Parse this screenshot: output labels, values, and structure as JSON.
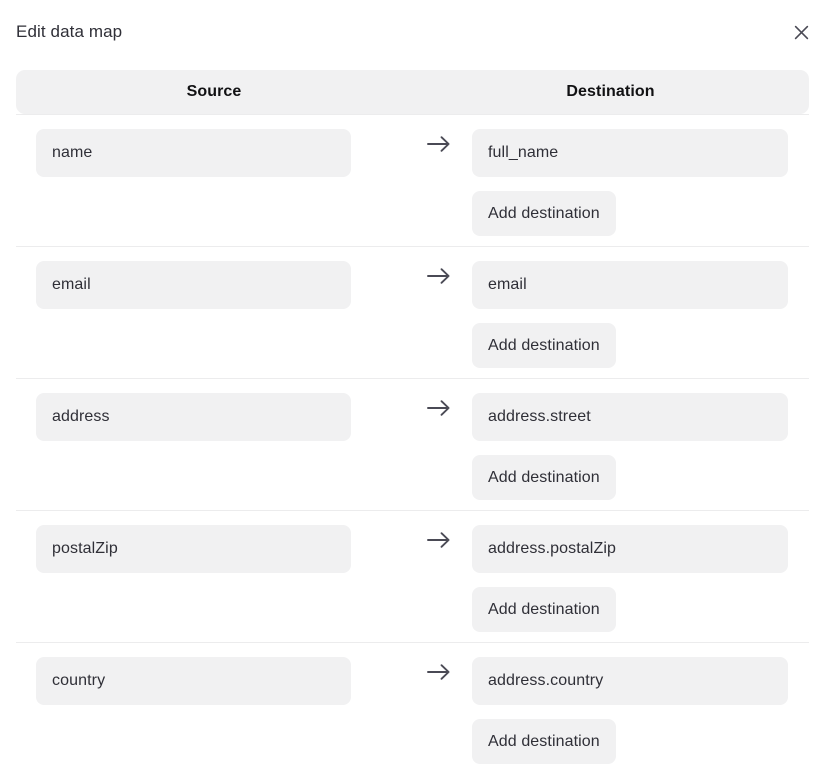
{
  "dialog": {
    "title": "Edit data map",
    "close_icon": "close-icon"
  },
  "table": {
    "columns": {
      "source": "Source",
      "destination": "Destination"
    },
    "arrow_icon": "arrow-right-icon",
    "add_destination_label": "Add destination",
    "rows": [
      {
        "source": "name",
        "destination": "full_name"
      },
      {
        "source": "email",
        "destination": "email"
      },
      {
        "source": "address",
        "destination": "address.street"
      },
      {
        "source": "postalZip",
        "destination": "address.postalZip"
      },
      {
        "source": "country",
        "destination": "address.country"
      }
    ]
  },
  "colors": {
    "page_background": "#ffffff",
    "field_background": "#f1f1f2",
    "text_primary": "#2f2f37",
    "header_text": "#111113",
    "divider": "#ececed"
  }
}
